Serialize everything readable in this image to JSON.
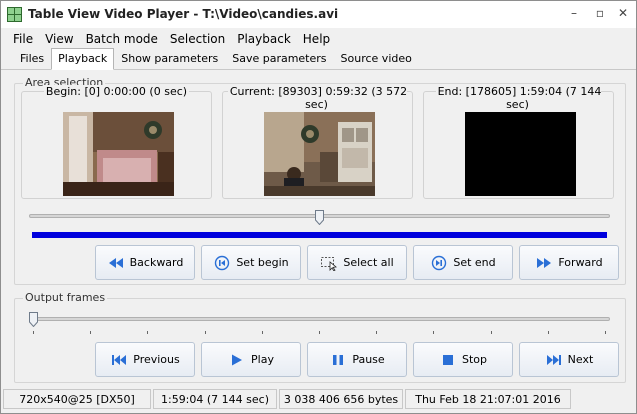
{
  "window": {
    "title": "Table View Video Player - T:\\Video\\candies.avi",
    "minimize_glyph": "–",
    "maximize_glyph": "▫",
    "close_glyph": "✕"
  },
  "menu": [
    "File",
    "View",
    "Batch mode",
    "Selection",
    "Playback",
    "Help"
  ],
  "tabs": [
    "Files",
    "Playback",
    "Show parameters",
    "Save parameters",
    "Source video"
  ],
  "active_tab": "Playback",
  "area_selection": {
    "label": "Area selection",
    "begin_caption": "Begin: [0] 0:00:00 (0 sec)",
    "current_caption": "Current: [89303] 0:59:32 (3 572 sec)",
    "end_caption": "End: [178605] 1:59:04 (7 144 sec)",
    "position_fraction": 0.5,
    "selection_fraction": 1.0,
    "selection_color": "#0000dd"
  },
  "selection_buttons": {
    "backward": "Backward",
    "set_begin": "Set begin",
    "select_all": "Select all",
    "set_end": "Set end",
    "forward": "Forward"
  },
  "output_frames": {
    "label": "Output frames",
    "position_fraction": 0.0,
    "tick_count": 11
  },
  "playback_buttons": {
    "previous": "Previous",
    "play": "Play",
    "pause": "Pause",
    "stop": "Stop",
    "next": "Next"
  },
  "icons": {
    "backward": "double-left-arrow-icon",
    "set_begin": "set-begin-icon",
    "select_all": "select-all-icon",
    "set_end": "set-end-icon",
    "forward": "double-right-arrow-icon",
    "previous": "previous-icon",
    "play": "play-icon",
    "pause": "pause-icon",
    "stop": "stop-icon",
    "next": "next-icon",
    "accent": "#2a6fd6"
  },
  "status": {
    "resolution": "720x540@25 [DX50]",
    "duration": "1:59:04 (7 144 sec)",
    "size": "3 038 406 656 bytes",
    "date": "Thu Feb 18 21:07:01 2016"
  }
}
